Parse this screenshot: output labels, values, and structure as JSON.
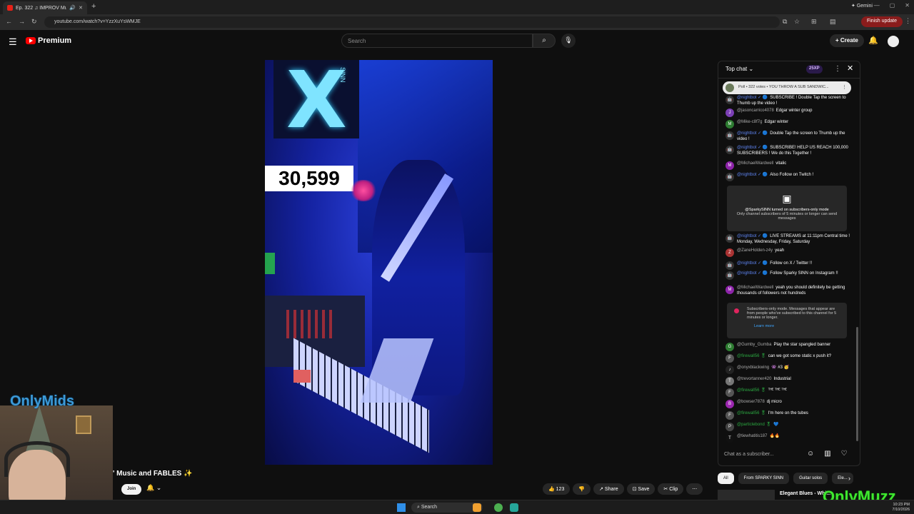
{
  "browser": {
    "tab_title": "Ep. 322 ♫ IMPROV Musi...",
    "url": "youtube.com/watch?v=YzzXuYsWMJE",
    "gemini_label": "Gemini",
    "finish_update_label": "Finish update"
  },
  "youtube": {
    "logo_text": "Premium",
    "search_placeholder": "Search",
    "create_label": "Create"
  },
  "video": {
    "subscriber_counter": "30,599",
    "sign_text": "SINN"
  },
  "below_video": {
    "title_fragment": "' Music and FABLES ✨",
    "join_label": "Join",
    "actions": {
      "like_count": "123",
      "share_label": "Share",
      "save_label": "Save",
      "clip_label": "Clip"
    }
  },
  "overlays": {
    "webcam_brand": "OnlyMids",
    "corner_brand": "OnlyMuzz"
  },
  "chat": {
    "header_label": "Top chat",
    "xp_badge": "25XP",
    "poll_text": "Poll • 322 votes • YOU THROW A SUB SANDWIC...",
    "messages": [
      {
        "user": "@nightbot ✓ 🔵",
        "text": "SUBSCRIBE ! Double Tap the screen to Thumb up the video !",
        "avatar": "🤖",
        "avatar_color": "#333",
        "user_style": "mod"
      },
      {
        "user": "@jasoncarrico4078",
        "text": "Edgar winter group",
        "avatar": "J",
        "avatar_color": "#7b3fb5",
        "user_style": ""
      },
      {
        "user": "@Mike-c8f7g",
        "text": "Edgar winter",
        "avatar": "M",
        "avatar_color": "#2e7d32",
        "user_style": ""
      },
      {
        "user": "@nightbot ✓ 🔵",
        "text": "Double Tap the screen to Thumb up the video !",
        "avatar": "🤖",
        "avatar_color": "#333",
        "user_style": "mod"
      },
      {
        "user": "@nightbot ✓ 🔵",
        "text": "SUBSCRIBE! HELP US REACH 100,000 SUBSCRIBERS ! We do this Together !",
        "avatar": "🤖",
        "avatar_color": "#333",
        "user_style": "mod"
      },
      {
        "user": "@MichaelWardwell",
        "text": "vitalic",
        "avatar": "M",
        "avatar_color": "#8e24aa",
        "user_style": ""
      },
      {
        "user": "@nightbot ✓ 🔵",
        "text": "Also Follow on Twitch !",
        "avatar": "🤖",
        "avatar_color": "#333",
        "user_style": "mod"
      },
      {
        "user": "@nightbot ✓ 🔵",
        "text": "LIVE STREAMS at 11:11pm Central time ! Monday, Wednesday, Friday, Saturday",
        "avatar": "🤖",
        "avatar_color": "#333",
        "user_style": "mod"
      },
      {
        "user": "@ZaneHolden-z4y",
        "text": "yeah",
        "avatar": "Z",
        "avatar_color": "#a33",
        "user_style": ""
      },
      {
        "user": "@nightbot ✓ 🔵",
        "text": "Follow on X / Twitter !!",
        "avatar": "🤖",
        "avatar_color": "#333",
        "user_style": "mod"
      },
      {
        "user": "@nightbot ✓ 🔵",
        "text": "Follow Sparky SINN on Instagram !!",
        "avatar": "🤖",
        "avatar_color": "#333",
        "user_style": "mod"
      },
      {
        "user": "@MichaelWardwell",
        "text": "yeah you should definitely be getting thousands of followers not hundreds",
        "avatar": "M",
        "avatar_color": "#8e24aa",
        "user_style": ""
      },
      {
        "user": "@Gumby_Gumba",
        "text": "Play the star spangled banner",
        "avatar": "G",
        "avatar_color": "#2e7d32",
        "user_style": ""
      },
      {
        "user": "@firewall56 🎖",
        "text": "can we got some static x push it?",
        "avatar": "F",
        "avatar_color": "#555",
        "user_style": "green"
      },
      {
        "user": "@onyxblackwing",
        "text": "👾 #3 🥳",
        "avatar": "♪",
        "avatar_color": "#222",
        "user_style": ""
      },
      {
        "user": "@trevortanner420",
        "text": "Industrial",
        "avatar": "T",
        "avatar_color": "#777",
        "user_style": ""
      },
      {
        "user": "@firewall56 🎖",
        "text": "ᵀᴴᴱ ᵀᴴᴱ ᵀᴴᴱ",
        "avatar": "F",
        "avatar_color": "#555",
        "user_style": "green"
      },
      {
        "user": "@bowser7878",
        "text": "dj micro",
        "avatar": "B",
        "avatar_color": "#9c27b0",
        "user_style": ""
      },
      {
        "user": "@firewall56 🎖",
        "text": "I'm here on the tubes",
        "avatar": "F",
        "avatar_color": "#555",
        "user_style": "green"
      },
      {
        "user": "@particlebond 🎖",
        "text": "💙",
        "avatar": "P",
        "avatar_color": "#444",
        "user_style": "green"
      },
      {
        "user": "@tiewhatitis187",
        "text": "🔥🔥",
        "avatar": "T",
        "avatar_color": "#111",
        "user_style": ""
      }
    ],
    "notice_subscribers": {
      "title": "@SparkySINN turned on subscribers-only mode",
      "body": "Only channel subscribers of 5 minutes or longer can send messages"
    },
    "notice_mode": {
      "body": "Subscribers-only mode. Messages that appear are from people who've subscribed to this channel for 5 minutes or longer.",
      "learn_more": "Learn more"
    },
    "input_placeholder": "Chat as a subscriber..."
  },
  "chips": [
    "All",
    "From SPARKY SINN",
    "Guitar solos",
    "Ele..."
  ],
  "up_next_title": "Elegant Blues - Whi...",
  "taskbar": {
    "search_label": "Search",
    "time": "10:23 PM",
    "date": "7/10/2026"
  }
}
